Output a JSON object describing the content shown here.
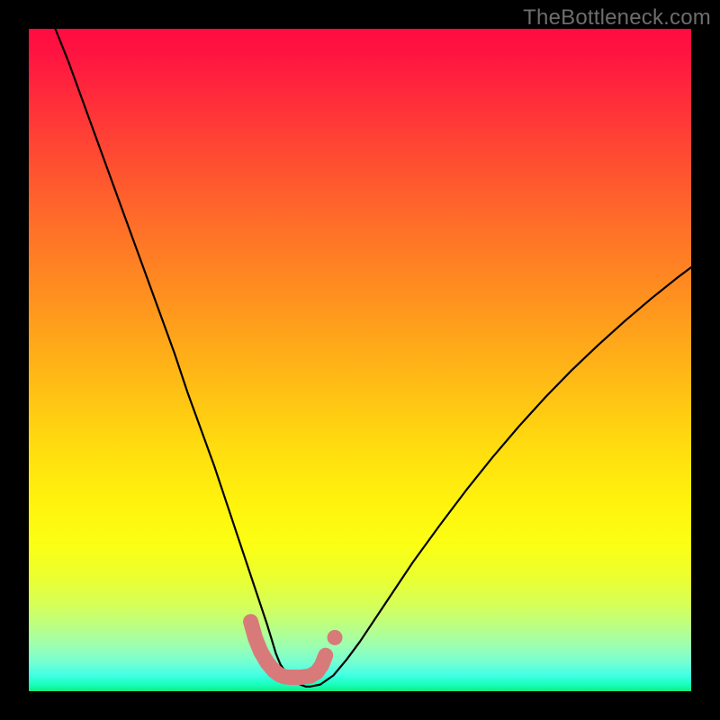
{
  "watermark": {
    "text": "TheBottleneck.com"
  },
  "chart_data": {
    "type": "line",
    "title": "",
    "xlabel": "",
    "ylabel": "",
    "xlim": [
      0,
      100
    ],
    "ylim": [
      0,
      100
    ],
    "grid": false,
    "series": [
      {
        "name": "bottleneck-curve",
        "color": "#000000",
        "x": [
          4,
          6,
          8,
          10,
          12,
          14,
          16,
          18,
          20,
          22,
          24,
          26,
          28,
          30,
          31.5,
          33,
          34,
          35,
          36,
          36.7,
          37.3,
          38,
          39,
          40,
          41,
          41.8,
          42.5,
          44,
          46,
          48,
          50,
          54,
          58,
          62,
          66,
          70,
          74,
          78,
          82,
          86,
          90,
          94,
          98,
          100
        ],
        "values": [
          100,
          95,
          89.5,
          84,
          78.5,
          73,
          67.5,
          62,
          56.5,
          51,
          45,
          39.5,
          34,
          28,
          23.5,
          19,
          16,
          13,
          10,
          7.7,
          5.7,
          4.0,
          2.6,
          1.6,
          1.0,
          0.7,
          0.7,
          1.0,
          2.4,
          4.8,
          7.5,
          13.5,
          19.5,
          25.0,
          30.3,
          35.3,
          40.0,
          44.4,
          48.5,
          52.3,
          55.9,
          59.3,
          62.5,
          64.0
        ]
      }
    ],
    "highlight_band": {
      "name": "optimal-range-marker",
      "color": "#d97a7a",
      "x": [
        33.5,
        34.2,
        35.0,
        36.0,
        37.0,
        37.8,
        38.5,
        39.5,
        41.0,
        42.5,
        43.5,
        44.2,
        44.8
      ],
      "values": [
        10.5,
        8.0,
        6.0,
        4.3,
        3.1,
        2.5,
        2.2,
        2.1,
        2.1,
        2.3,
        2.9,
        3.9,
        5.4
      ]
    },
    "highlight_dot": {
      "name": "marker-dot",
      "color": "#d97a7a",
      "x": 46.2,
      "value": 8.1
    },
    "gradient_stops": [
      {
        "pct": 0,
        "color": "#ff0b41"
      },
      {
        "pct": 15,
        "color": "#ff3c36"
      },
      {
        "pct": 40,
        "color": "#ff8f1f"
      },
      {
        "pct": 63,
        "color": "#ffdc0f"
      },
      {
        "pct": 78,
        "color": "#fbff14"
      },
      {
        "pct": 90,
        "color": "#bcff82"
      },
      {
        "pct": 97,
        "color": "#44ffe6"
      },
      {
        "pct": 100,
        "color": "#14e97f"
      }
    ]
  }
}
